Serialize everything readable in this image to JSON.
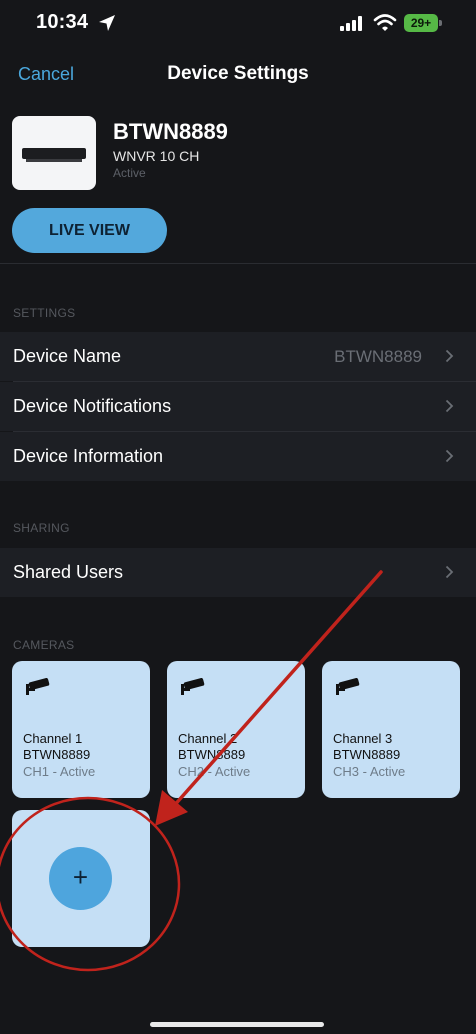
{
  "status_bar": {
    "time": "10:34",
    "battery": "29+"
  },
  "nav": {
    "cancel": "Cancel",
    "title": "Device Settings"
  },
  "device": {
    "name": "BTWN8889",
    "model": "WNVR 10 CH",
    "status": "Active",
    "live_view": "LIVE VIEW"
  },
  "settings": {
    "header": "SETTINGS",
    "rows": [
      {
        "label": "Device Name",
        "value": "BTWN8889"
      },
      {
        "label": "Device Notifications"
      },
      {
        "label": "Device Information"
      }
    ]
  },
  "sharing": {
    "header": "SHARING",
    "rows": [
      {
        "label": "Shared Users"
      }
    ]
  },
  "cameras": {
    "header": "CAMERAS",
    "items": [
      {
        "channel": "Channel 1",
        "device": "BTWN8889",
        "status": "CH1 - Active"
      },
      {
        "channel": "Channel 2",
        "device": "BTWN8889",
        "status": "CH2 - Active"
      },
      {
        "channel": "Channel 3",
        "device": "BTWN8889",
        "status": "CH3 - Active"
      }
    ],
    "add_symbol": "+"
  },
  "annotation": {
    "color": "#c0231c"
  },
  "colors": {
    "accent": "#53a8dc",
    "background": "#151619",
    "row": "#1d1f24",
    "card": "#c5dff5"
  }
}
